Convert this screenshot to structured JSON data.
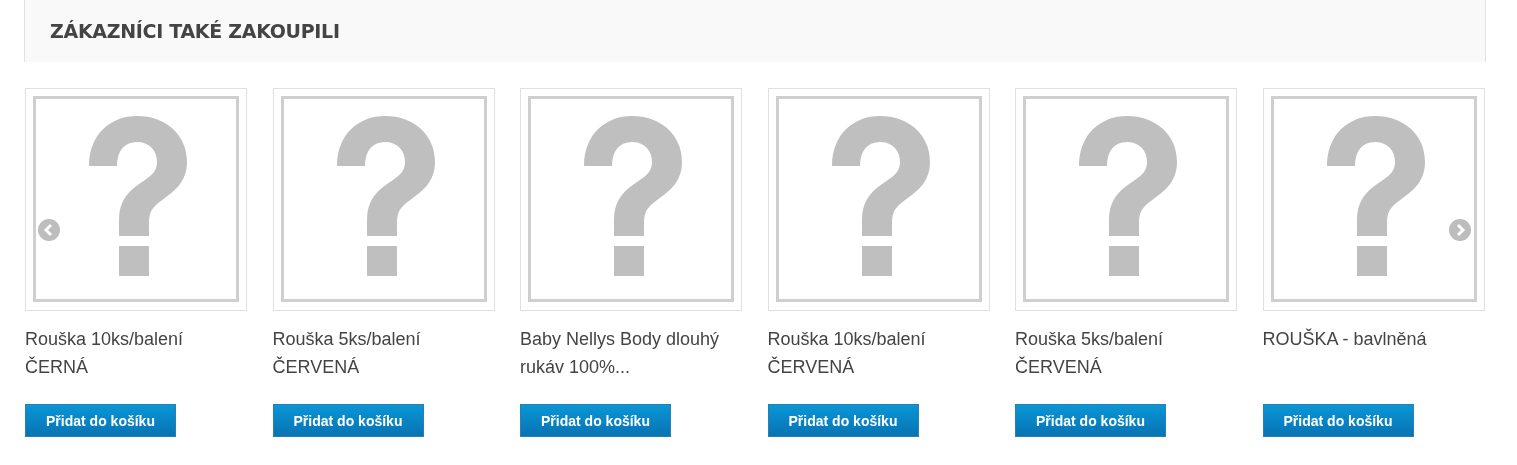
{
  "section": {
    "title": "ZÁKAZNÍCI TAKÉ ZAKOUPILI"
  },
  "products": [
    {
      "name": "Rouška 10ks/balení ČERNÁ",
      "button": "Přidat do košíku"
    },
    {
      "name": "Rouška 5ks/balení ČERVENÁ",
      "button": "Přidat do košíku"
    },
    {
      "name": "Baby Nellys Body dlouhý rukáv 100%...",
      "button": "Přidat do košíku"
    },
    {
      "name": "Rouška 10ks/balení ČERVENÁ",
      "button": "Přidat do košíku"
    },
    {
      "name": "Rouška 5ks/balení ČERVENÁ",
      "button": "Přidat do košíku"
    },
    {
      "name": "ROUŠKA - bavlněná",
      "button": "Přidat do košíku"
    }
  ]
}
